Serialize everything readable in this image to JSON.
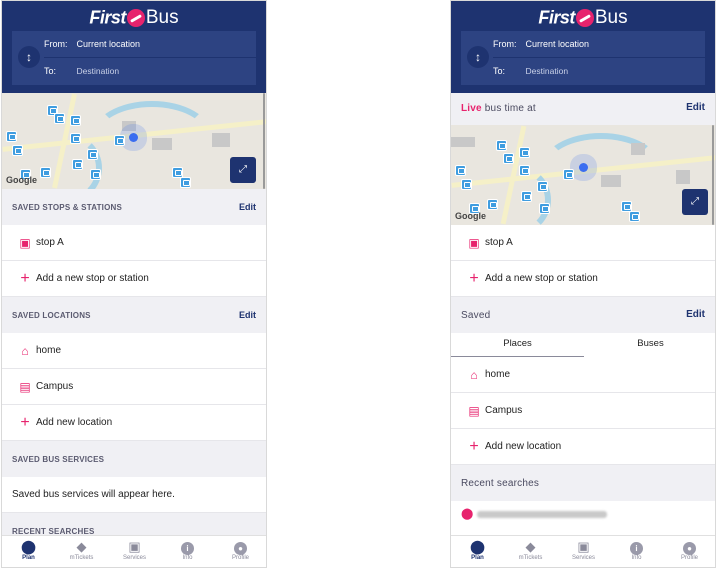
{
  "brand": {
    "first": "First",
    "bus": "Bus"
  },
  "journey": {
    "from_label": "From:",
    "from_value": "Current location",
    "to_label": "To:",
    "to_value": "Destination"
  },
  "map": {
    "google_label": "Google"
  },
  "left": {
    "saved_stops": {
      "title": "SAVED STOPS & STATIONS",
      "edit": "Edit"
    },
    "stop_a": "stop A",
    "add_stop": "Add a new stop or station",
    "saved_locations": {
      "title": "SAVED LOCATIONS",
      "edit": "Edit"
    },
    "home": "home",
    "campus": "Campus",
    "add_location": "Add new location",
    "saved_services": {
      "title": "SAVED BUS SERVICES"
    },
    "services_empty": "Saved bus services will appear here.",
    "recent": {
      "title": "RECENT SEARCHES"
    }
  },
  "right": {
    "live": {
      "live_word": "Live",
      "rest": " bus time at",
      "edit": "Edit"
    },
    "stop_a": "stop A",
    "add_stop": "Add a new stop or station",
    "saved": {
      "title": "Saved",
      "edit": "Edit"
    },
    "tabs": {
      "places": "Places",
      "buses": "Buses"
    },
    "home": "home",
    "campus": "Campus",
    "add_location": "Add new location",
    "recent": {
      "title": "Recent searches"
    }
  },
  "nav": [
    {
      "label": "Plan",
      "icon": "location-pin-icon"
    },
    {
      "label": "mTickets",
      "icon": "ticket-icon"
    },
    {
      "label": "Services",
      "icon": "bus-icon"
    },
    {
      "label": "Info",
      "icon": "info-icon"
    },
    {
      "label": "Profile",
      "icon": "profile-icon"
    }
  ],
  "colors": {
    "brand_navy": "#1e3370",
    "accent_pink": "#e7236d",
    "stop_blue": "#3f9de0"
  }
}
